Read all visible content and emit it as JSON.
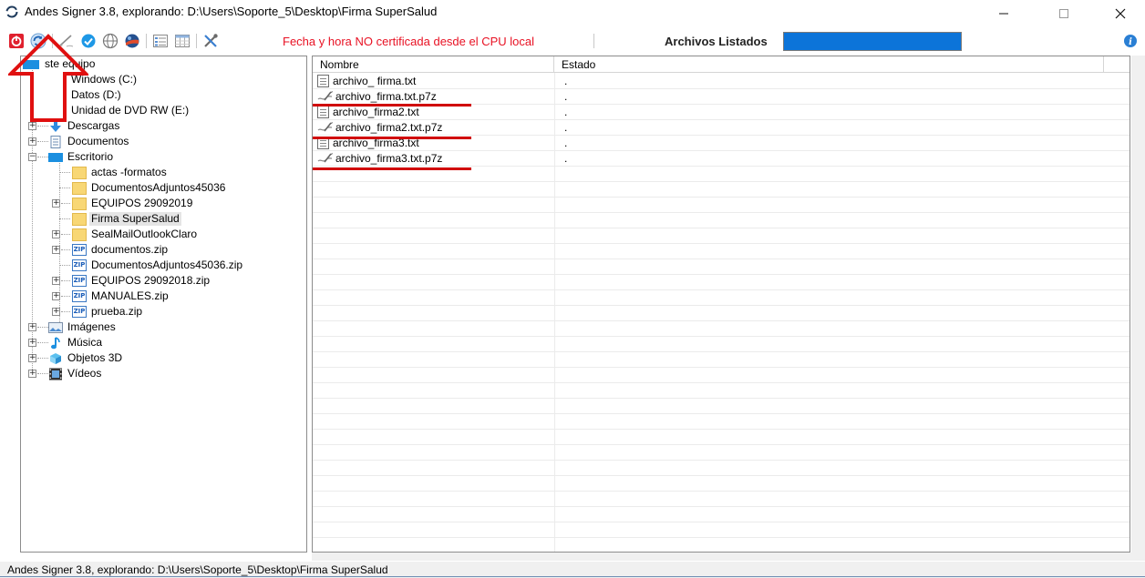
{
  "window": {
    "title": "Andes Signer 3.8, explorando: D:\\Users\\Soporte_5\\Desktop\\Firma SuperSalud"
  },
  "toolbar": {
    "warning": "Fecha y hora NO certificada desde el CPU local",
    "files_label": "Archivos Listados",
    "files_progress": 1.0,
    "accent_color": "#0c74d9",
    "warning_color": "#e81123"
  },
  "tree": {
    "items": [
      {
        "label": "Este equipo",
        "visible_label": "ste equipo"
      },
      {
        "label": "Windows (C:)"
      },
      {
        "label": "Datos (D:)"
      },
      {
        "label": "Unidad de DVD RW (E:)"
      },
      {
        "label": "Descargas"
      },
      {
        "label": "Documentos"
      },
      {
        "label": "Escritorio"
      },
      {
        "label": "actas -formatos"
      },
      {
        "label": "DocumentosAdjuntos45036"
      },
      {
        "label": "EQUIPOS 29092019"
      },
      {
        "label": "Firma SuperSalud"
      },
      {
        "label": "SealMailOutlookClaro"
      },
      {
        "label": "documentos.zip"
      },
      {
        "label": "DocumentosAdjuntos45036.zip"
      },
      {
        "label": "EQUIPOS 29092018.zip"
      },
      {
        "label": "MANUALES.zip"
      },
      {
        "label": "prueba.zip"
      },
      {
        "label": "Imágenes"
      },
      {
        "label": "Música"
      },
      {
        "label": "Objetos 3D"
      },
      {
        "label": "Vídeos"
      }
    ]
  },
  "list": {
    "columns": [
      "Nombre",
      "Estado"
    ],
    "rows": [
      {
        "name": "archivo_ firma.txt",
        "state": ".",
        "type": "text-file-icon"
      },
      {
        "name": "archivo_firma.txt.p7z",
        "state": ".",
        "type": "signed-file-icon",
        "highlighted": true
      },
      {
        "name": "archivo_firma2.txt",
        "state": ".",
        "type": "text-file-icon"
      },
      {
        "name": "archivo_firma2.txt.p7z",
        "state": ".",
        "type": "signed-file-icon",
        "highlighted": true
      },
      {
        "name": "archivo_firma3.txt",
        "state": ".",
        "type": "text-file-icon"
      },
      {
        "name": "archivo_firma3.txt.p7z",
        "state": ".",
        "type": "signed-file-icon",
        "highlighted": true
      }
    ]
  },
  "status": {
    "text": "Andes Signer 3.8, explorando: D:\\Users\\Soporte_5\\Desktop\\Firma SuperSalud"
  }
}
